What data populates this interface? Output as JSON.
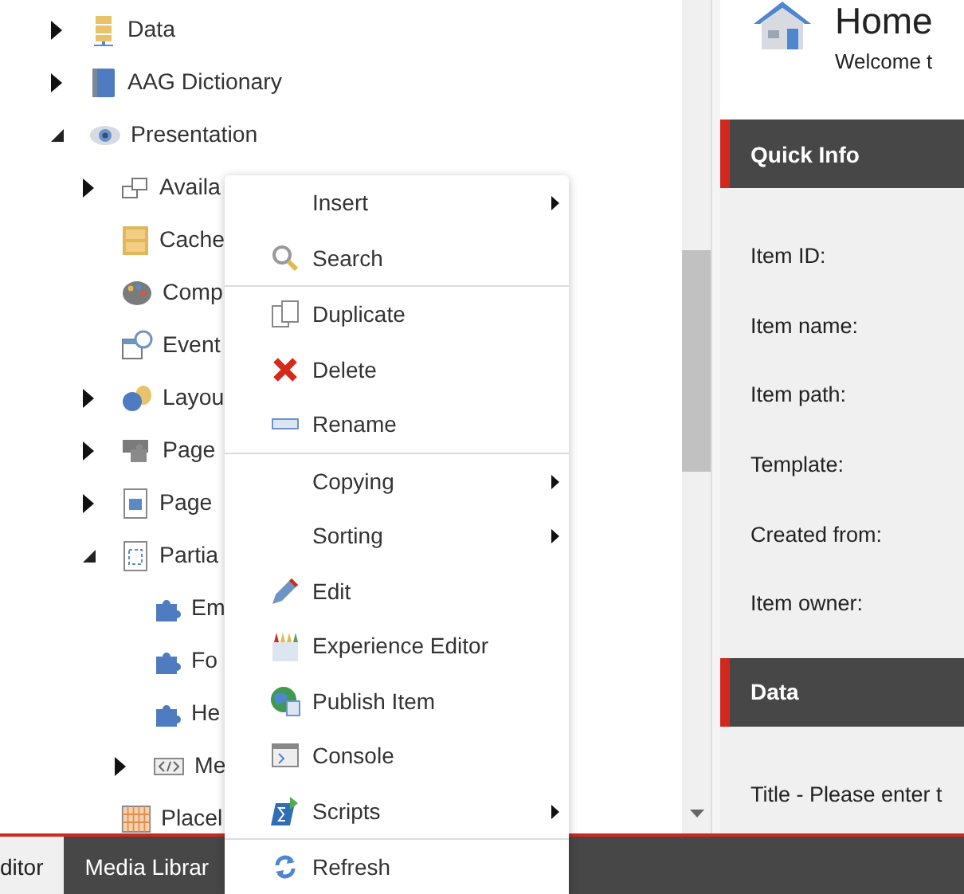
{
  "tree": {
    "items": [
      {
        "label": "Data",
        "expanded": false
      },
      {
        "label": "AAG Dictionary",
        "expanded": false
      },
      {
        "label": "Presentation",
        "expanded": true,
        "children": [
          {
            "label": "Availa",
            "expanded": false
          },
          {
            "label": "Cache"
          },
          {
            "label": "Comp"
          },
          {
            "label": "Event"
          },
          {
            "label": "Layou",
            "expanded": false
          },
          {
            "label": "Page",
            "expanded": false
          },
          {
            "label": "Page",
            "expanded": false
          },
          {
            "label": "Partia",
            "expanded": true,
            "children": [
              {
                "label": "Em"
              },
              {
                "label": "Fo"
              },
              {
                "label": "He"
              },
              {
                "label": "Me",
                "expanded": false
              }
            ]
          },
          {
            "label": "Placel"
          }
        ]
      }
    ]
  },
  "bottom_tabs": [
    {
      "label": "ditor",
      "selected": true
    },
    {
      "label": "Media Librar",
      "selected": false
    }
  ],
  "context_menu": {
    "groups": [
      [
        {
          "label": "Insert",
          "submenu": true
        },
        {
          "label": "Search",
          "submenu": false
        }
      ],
      [
        {
          "label": "Duplicate",
          "submenu": false
        },
        {
          "label": "Delete",
          "submenu": false
        },
        {
          "label": "Rename",
          "submenu": false
        }
      ],
      [
        {
          "label": "Copying",
          "submenu": true
        },
        {
          "label": "Sorting",
          "submenu": true
        },
        {
          "label": "Edit",
          "submenu": false
        },
        {
          "label": "Experience Editor",
          "submenu": false
        },
        {
          "label": "Publish Item",
          "submenu": false
        },
        {
          "label": "Console",
          "submenu": false
        },
        {
          "label": "Scripts",
          "submenu": true
        }
      ],
      [
        {
          "label": "Refresh",
          "submenu": false
        }
      ]
    ]
  },
  "content": {
    "title": "Home",
    "subtitle": "Welcome t",
    "sections": [
      {
        "title": "Quick Info",
        "fields": [
          "Item ID:",
          "Item name:",
          "Item path:",
          "Template:",
          "Created from:",
          "Item owner:"
        ]
      },
      {
        "title": "Data",
        "fields": [
          "Title - Please enter t"
        ]
      }
    ]
  }
}
